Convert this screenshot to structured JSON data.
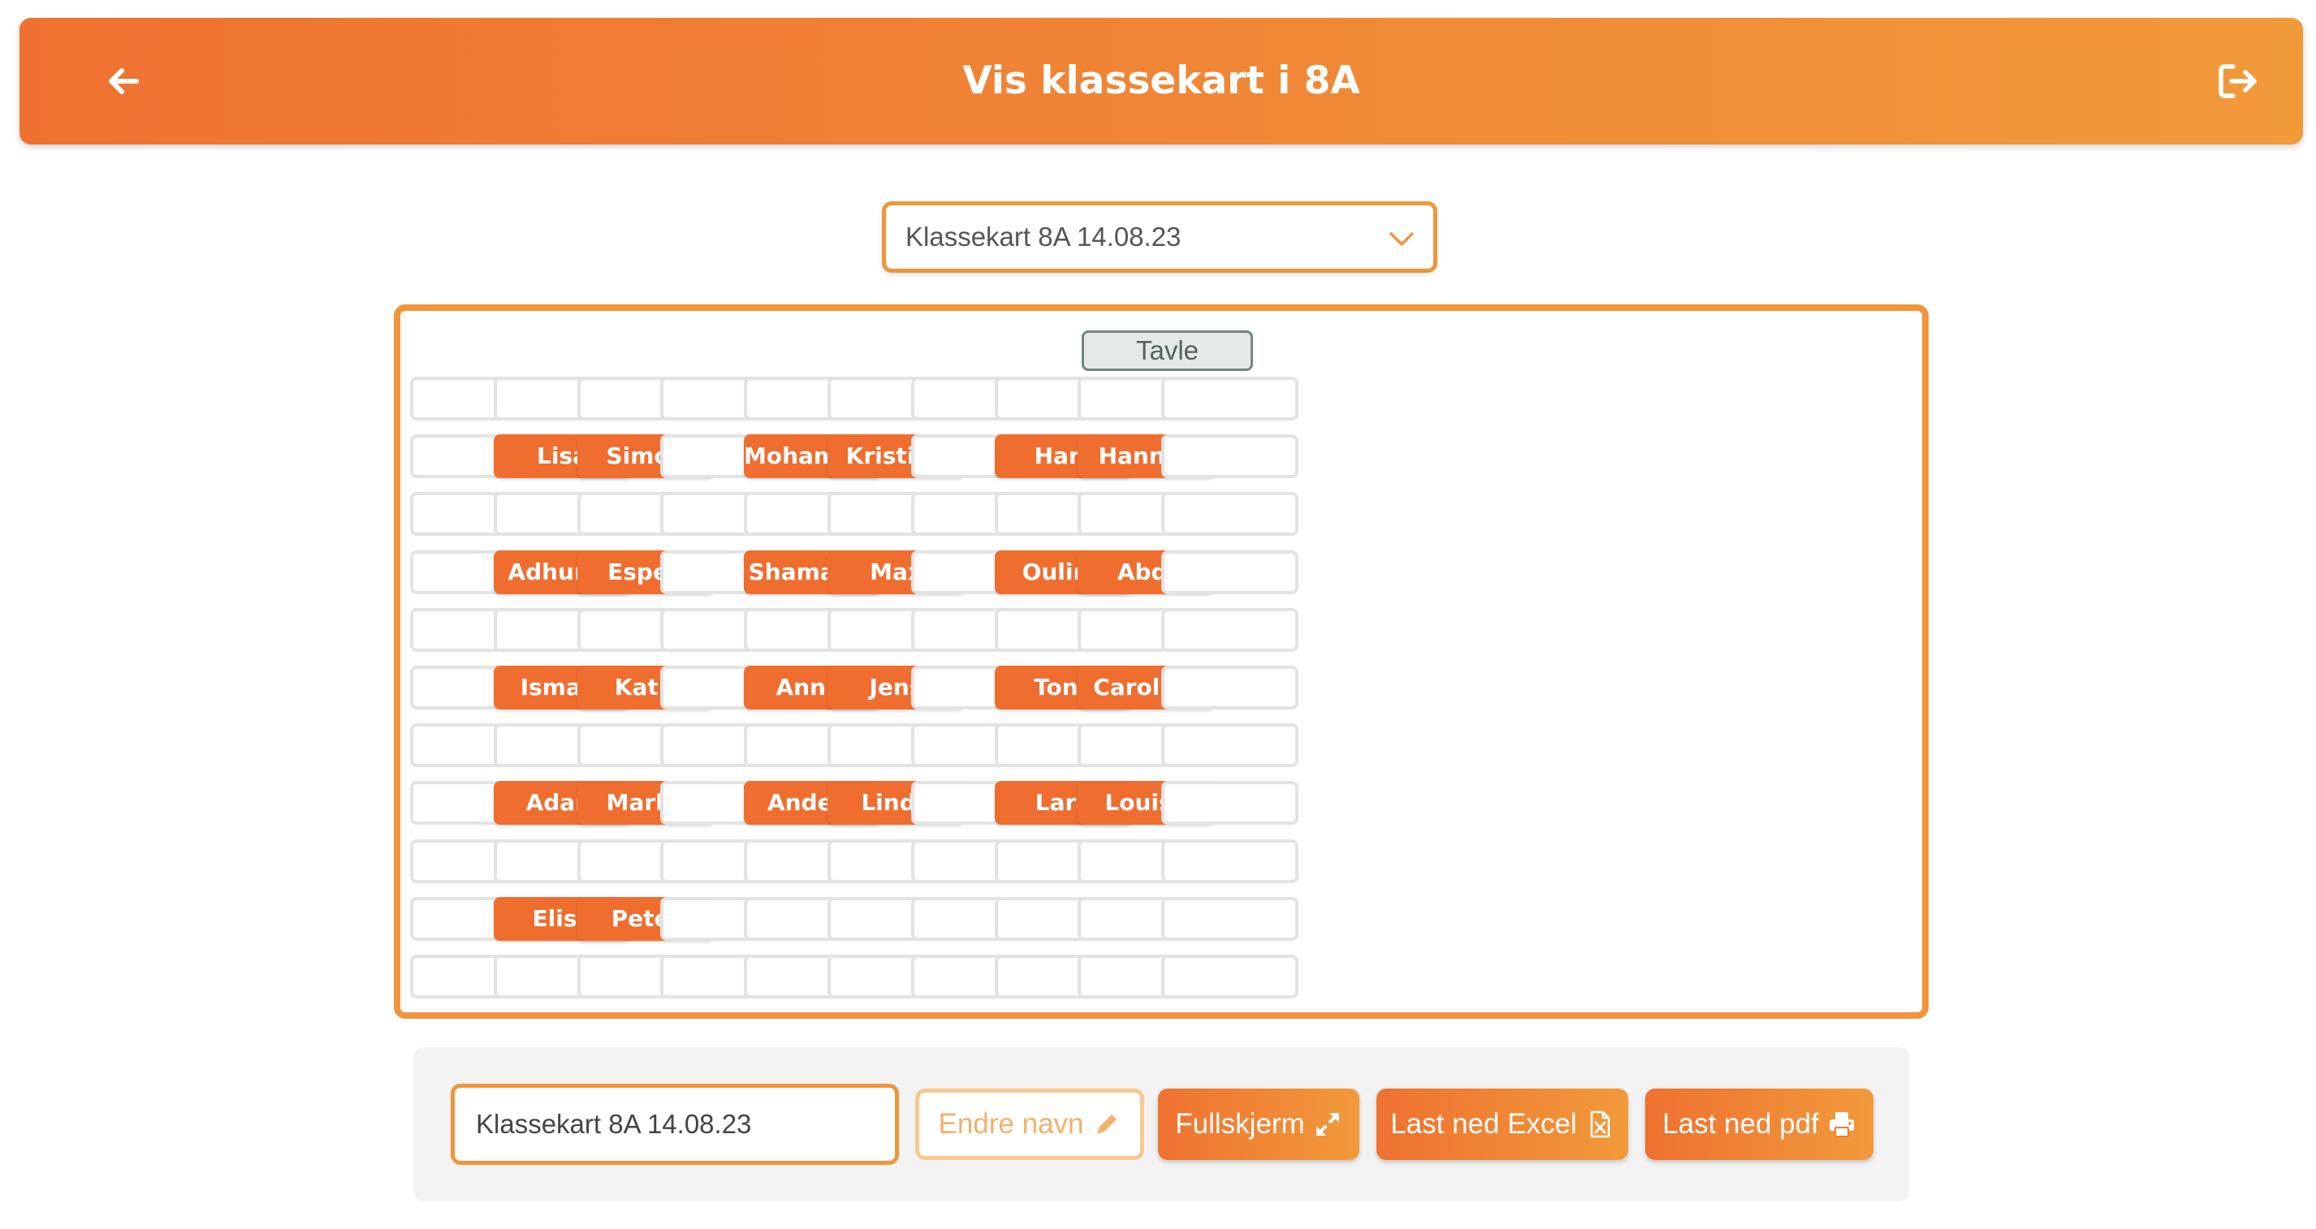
{
  "header": {
    "title": "Vis klassekart i 8A"
  },
  "chart_select": {
    "value": "Klassekart 8A 14.08.23"
  },
  "classroom": {
    "board_label": "Tavle",
    "rows": [
      [
        "",
        "",
        "",
        "",
        "",
        "",
        "",
        "",
        "",
        ""
      ],
      [
        "",
        "Lisa",
        "Simon",
        "",
        "Mohammed",
        "Kristine",
        "",
        "Hani",
        "Hannes",
        ""
      ],
      [
        "",
        "",
        "",
        "",
        "",
        "",
        "",
        "",
        "",
        ""
      ],
      [
        "",
        "Adhurim",
        "Espen",
        "",
        "Shamarke",
        "Max",
        "",
        "Ouline",
        "Abdi",
        ""
      ],
      [
        "",
        "",
        "",
        "",
        "",
        "",
        "",
        "",
        "",
        ""
      ],
      [
        "",
        "Ismael",
        "Katri",
        "",
        "Annie",
        "Jens",
        "",
        "Tony",
        "Caroline",
        ""
      ],
      [
        "",
        "",
        "",
        "",
        "",
        "",
        "",
        "",
        "",
        ""
      ],
      [
        "",
        "Adam",
        "Marko",
        "",
        "Anders",
        "Linda",
        "",
        "Lara",
        "Louisa",
        ""
      ],
      [
        "",
        "",
        "",
        "",
        "",
        "",
        "",
        "",
        "",
        ""
      ],
      [
        "",
        "Elise",
        "Peter",
        "",
        "",
        "",
        "",
        "",
        "",
        ""
      ],
      [
        "",
        "",
        "",
        "",
        "",
        "",
        "",
        "",
        "",
        ""
      ]
    ]
  },
  "toolbar": {
    "name_value": "Klassekart 8A 14.08.23",
    "rename_label": "Endre navn",
    "fullscreen_label": "Fullskjerm",
    "excel_label": "Last ned Excel",
    "pdf_label": "Last ned pdf"
  },
  "colors": {
    "accent": "#ef6d2f",
    "accent_light": "#f19a3a",
    "border": "#f0953a",
    "board_bg": "#e4e9e7"
  },
  "icons": {
    "back": "arrow-left-icon",
    "logout": "logout-icon",
    "dropdown": "chevron-down-icon",
    "rename": "pencil-icon",
    "fullscreen": "expand-icon",
    "excel": "excel-file-icon",
    "pdf": "printer-icon"
  }
}
